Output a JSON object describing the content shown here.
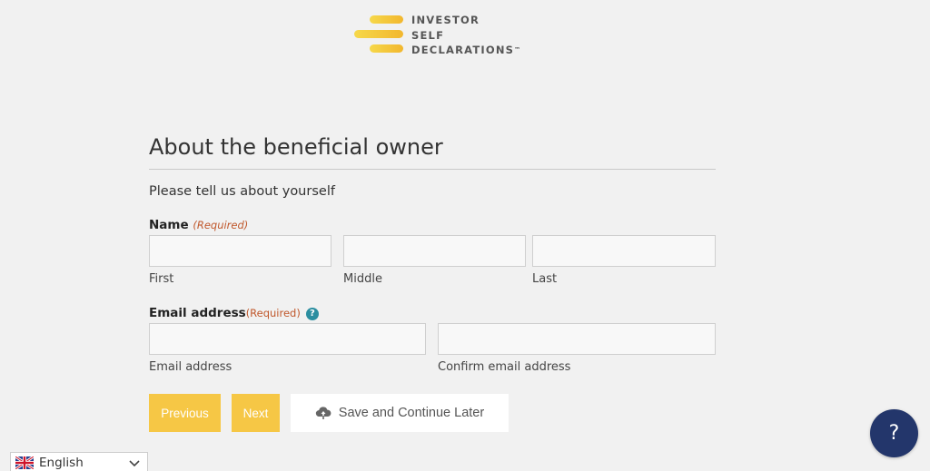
{
  "logo": {
    "line1": "INVESTOR",
    "line2": "SELF",
    "line3": "DECLARATIONS",
    "trademark": "™",
    "bar_color_start": "#f6d84a",
    "bar_color_end": "#f2b72e"
  },
  "form": {
    "heading": "About the beneficial owner",
    "intro": "Please tell us about yourself",
    "name": {
      "label": "Name",
      "required": "(Required)",
      "first_label": "First",
      "middle_label": "Middle",
      "last_label": "Last",
      "first_value": "",
      "middle_value": "",
      "last_value": ""
    },
    "email": {
      "label": "Email address",
      "required": "(Required)",
      "help_icon": "question-circle-icon",
      "email_label": "Email address",
      "confirm_label": "Confirm email address",
      "email_value": "",
      "confirm_value": ""
    },
    "buttons": {
      "previous": "Previous",
      "next": "Next",
      "save_later": "Save and Continue Later",
      "save_icon": "cloud-upload-icon"
    }
  },
  "language": {
    "selected": "English",
    "flag_icon": "uk-flag-icon"
  },
  "help_bubble": {
    "label": "?"
  },
  "colors": {
    "accent_yellow": "#f6c745",
    "required_text": "#c0582c",
    "help_icon": "#2b8ea0",
    "help_bubble": "#23366b",
    "background": "#f1f1f1"
  }
}
